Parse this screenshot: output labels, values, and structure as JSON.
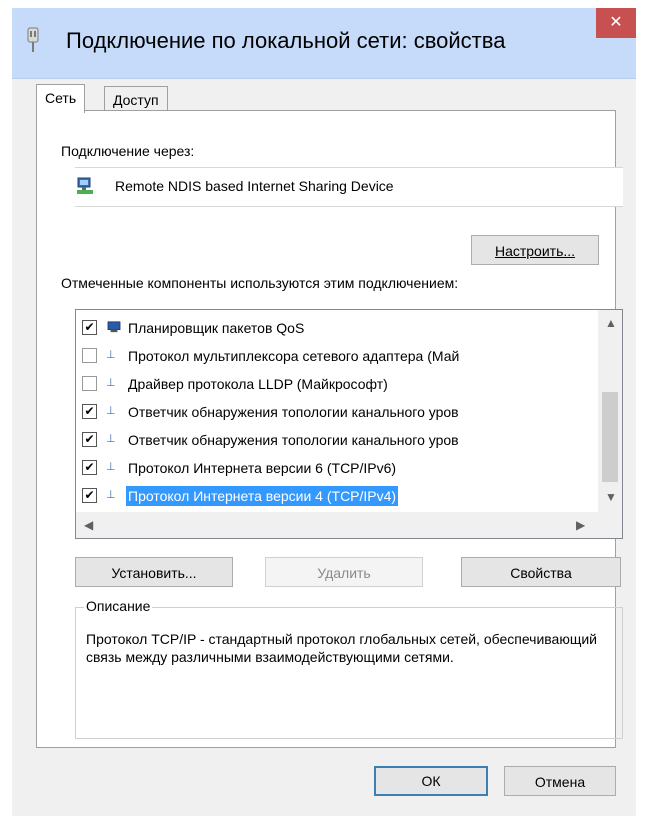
{
  "window": {
    "title": "Подключение по локальной сети: свойства",
    "close_glyph": "✕"
  },
  "tabs": [
    {
      "label": "Сеть",
      "active": true
    },
    {
      "label": "Доступ",
      "active": false
    }
  ],
  "connect_via": {
    "label": "Подключение через:",
    "device_name": "Remote NDIS based Internet Sharing Device",
    "configure_button": "Настроить..."
  },
  "components": {
    "label": "Отмеченные компоненты используются этим подключением:",
    "items": [
      {
        "checked": true,
        "icon": "qos-icon",
        "label": "Планировщик пакетов QoS",
        "selected": false
      },
      {
        "checked": false,
        "icon": "protocol-icon",
        "label": "Протокол мультиплексора сетевого адаптера (Май",
        "selected": false
      },
      {
        "checked": false,
        "icon": "protocol-icon",
        "label": "Драйвер протокола LLDP (Майкрософт)",
        "selected": false
      },
      {
        "checked": true,
        "icon": "protocol-icon",
        "label": "Ответчик обнаружения топологии канального уров",
        "selected": false
      },
      {
        "checked": true,
        "icon": "protocol-icon",
        "label": "Ответчик обнаружения топологии канального уров",
        "selected": false
      },
      {
        "checked": true,
        "icon": "protocol-icon",
        "label": "Протокол Интернета версии 6 (TCP/IPv6)",
        "selected": false
      },
      {
        "checked": true,
        "icon": "protocol-icon",
        "label": "Протокол Интернета версии 4 (TCP/IPv4)",
        "selected": true
      }
    ]
  },
  "actions": {
    "install": "Установить...",
    "remove": "Удалить",
    "properties": "Свойства"
  },
  "description": {
    "title": "Описание",
    "text": "Протокол TCP/IP - стандартный протокол глобальных сетей, обеспечивающий связь между различными взаимодействующими сетями."
  },
  "footer": {
    "ok": "ОК",
    "cancel": "Отмена"
  },
  "colors": {
    "titlebar": "#c6dafa",
    "close": "#c75050",
    "selection": "#3399ff"
  }
}
